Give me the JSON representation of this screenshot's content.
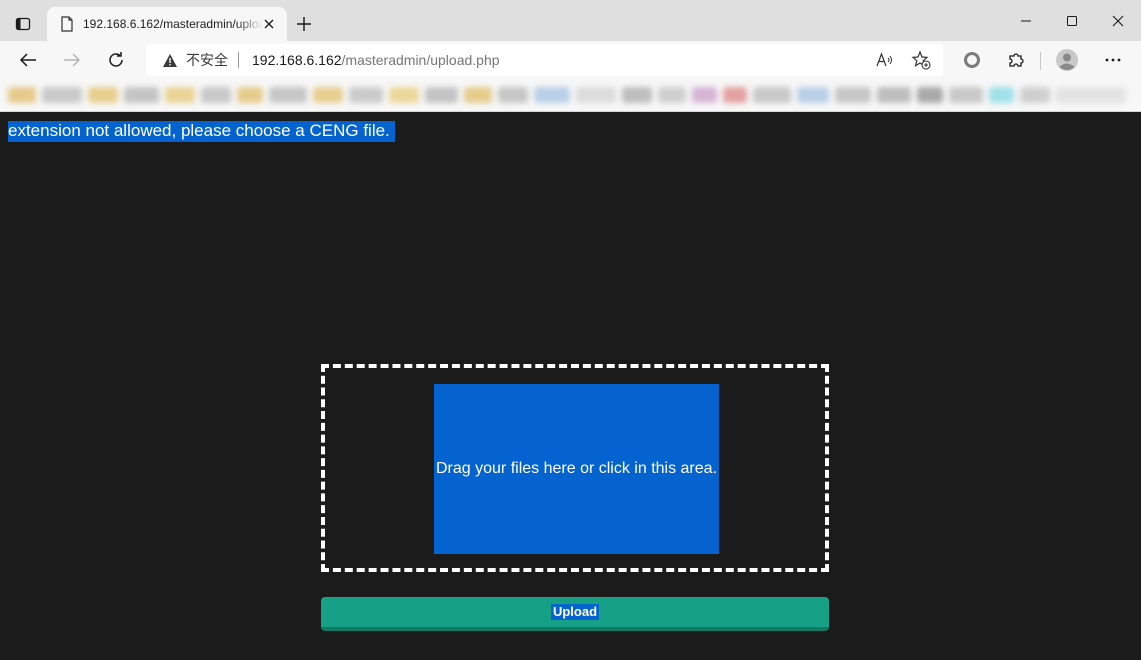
{
  "browser": {
    "tab": {
      "title": "192.168.6.162/masteradmin/upload.php"
    },
    "address_bar": {
      "security_label": "不安全",
      "url_host": "192.168.6.162",
      "url_path": "/masteradmin/upload.php"
    },
    "icons": {
      "tab_actions": "tab-actions-icon",
      "page": "page-icon",
      "tab_close": "close-icon",
      "new_tab": "plus-icon",
      "minimize": "minimize-icon",
      "maximize": "maximize-icon",
      "close_window": "close-icon",
      "back": "back-arrow-icon",
      "forward": "forward-arrow-icon",
      "refresh": "refresh-icon",
      "warning": "warning-icon",
      "read_aloud": "read-aloud-icon",
      "favorites_add": "star-plus-icon",
      "extension_circle": "circle-icon",
      "extensions": "puzzle-icon",
      "profile": "avatar-icon",
      "more": "more-icon"
    }
  },
  "page": {
    "error_message": "extension not allowed, please choose a CENG file.",
    "dropzone": {
      "text": "Drag your files here or click in this area."
    },
    "upload_button": {
      "label": "Upload"
    }
  },
  "colors": {
    "page_background": "#1b1b1b",
    "highlight_blue": "#0563cf",
    "upload_green": "#16a085",
    "dropzone_border": "#ffffff"
  }
}
